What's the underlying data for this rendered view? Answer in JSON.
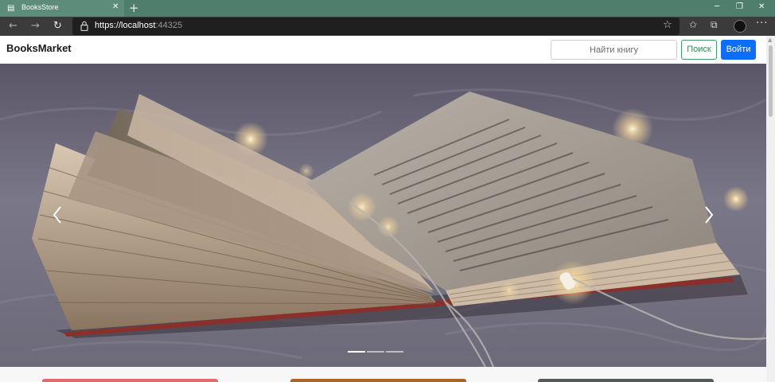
{
  "browser": {
    "tab": {
      "title": "BooksStore"
    },
    "address": {
      "protocol_host": "https://localhost",
      "port": ":44325"
    }
  },
  "site": {
    "brand": "BooksMarket",
    "search": {
      "placeholder": "Найти книгу"
    },
    "search_button": "Поиск",
    "login_button": "Войти",
    "colors": {
      "primary": "#0d6efd",
      "success": "#198754"
    }
  },
  "carousel": {
    "slide_icon": "open-book-photo",
    "indicators_count": 3,
    "active_index": 0
  },
  "cards": {
    "colors": [
      "#e06b6b",
      "#a8652a",
      "#555b5c"
    ]
  }
}
